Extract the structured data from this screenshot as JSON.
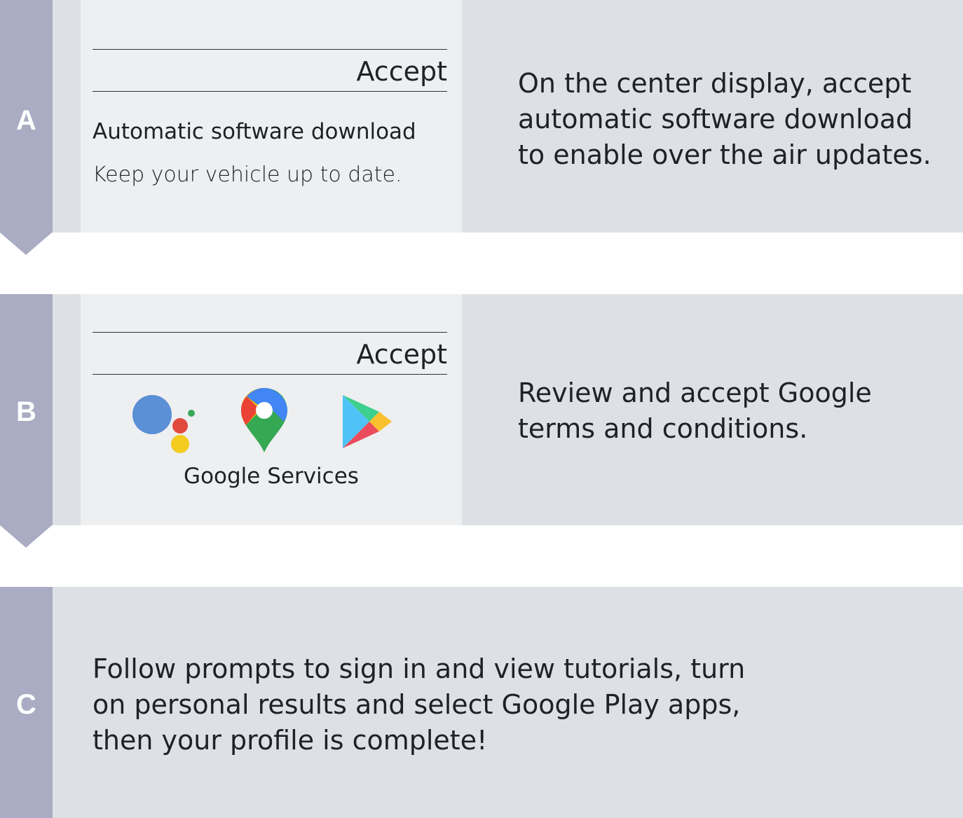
{
  "steps": [
    {
      "letter": "A",
      "screen": {
        "accept_label": "Accept",
        "title": "Automatic software download",
        "subtitle": "Keep your vehicle up to date."
      },
      "description": "On the center display, accept\nautomatic software download\nto enable over the air updates."
    },
    {
      "letter": "B",
      "screen": {
        "accept_label": "Accept",
        "icons": [
          "google-assistant-icon",
          "google-maps-icon",
          "google-play-icon"
        ],
        "services_label": "Google Services"
      },
      "description": "Review and accept Google\nterms and conditions."
    },
    {
      "letter": "C",
      "description": "Follow prompts to sign in and view tutorials, turn\non personal results and select Google Play apps,\nthen your profile is complete!"
    }
  ],
  "colors": {
    "tab": "#a9acc2",
    "panel": "#dde0e4",
    "screen": "#eeeff1",
    "text": "#1e2126"
  }
}
